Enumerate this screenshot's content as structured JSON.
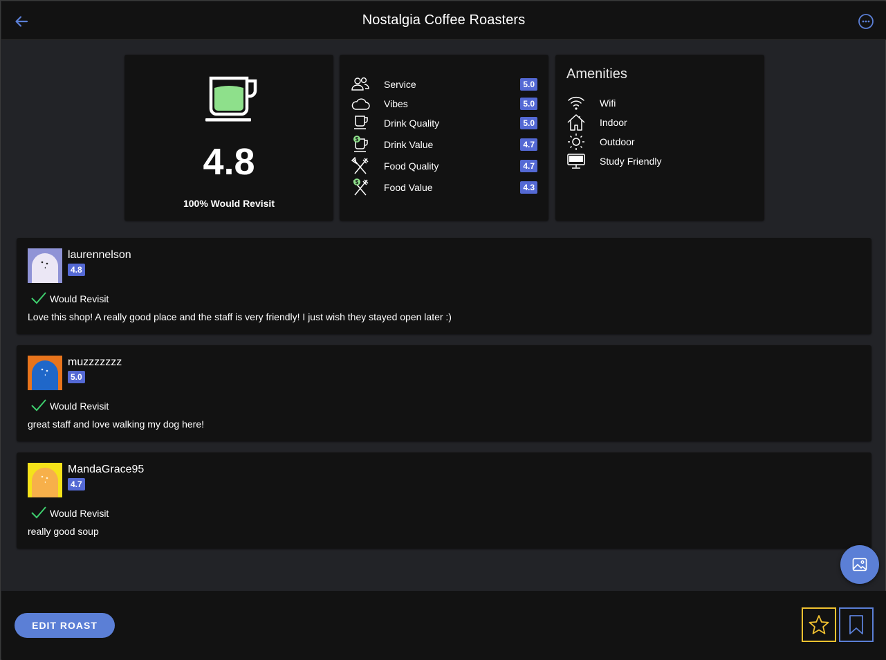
{
  "header": {
    "title": "Nostalgia Coffee Roasters",
    "back_icon": "arrow-left-icon",
    "more_icon": "more-horizontal-circle-icon",
    "accent": "#5b7fd6"
  },
  "summary": {
    "icon": "coffee-cup-icon",
    "cup_fill_color": "#8ee08b",
    "score": "4.8",
    "revisit": "100% Would Revisit"
  },
  "ratings": [
    {
      "label": "Service",
      "value": "5.0",
      "icon": "people-icon"
    },
    {
      "label": "Vibes",
      "value": "5.0",
      "icon": "cloud-icon"
    },
    {
      "label": "Drink Quality",
      "value": "5.0",
      "icon": "cup-icon"
    },
    {
      "label": "Drink Value",
      "value": "4.7",
      "icon": "cup-dollar-icon"
    },
    {
      "label": "Food Quality",
      "value": "4.7",
      "icon": "utensils-icon"
    },
    {
      "label": "Food Value",
      "value": "4.3",
      "icon": "utensils-dollar-icon"
    }
  ],
  "amenities": {
    "title": "Amenities",
    "items": [
      {
        "label": "Wifi",
        "icon": "wifi-icon"
      },
      {
        "label": "Indoor",
        "icon": "house-icon"
      },
      {
        "label": "Outdoor",
        "icon": "sun-icon"
      },
      {
        "label": "Study Friendly",
        "icon": "monitor-icon"
      }
    ]
  },
  "reviews": [
    {
      "user": "laurennelson",
      "rating": "4.8",
      "revisit": "Would Revisit",
      "text": "Love this shop! A really good place and the staff is very friendly! I just wish they stayed open later :)",
      "avatar_bg": "#8f93d6",
      "avatar_ghost": "#ebe7f5"
    },
    {
      "user": "muzzzzzzz",
      "rating": "5.0",
      "revisit": "Would Revisit",
      "text": "great staff and love walking my dog here!",
      "avatar_bg": "#e8741c",
      "avatar_ghost": "#1f67c9"
    },
    {
      "user": "MandaGrace95",
      "rating": "4.7",
      "revisit": "Would Revisit",
      "text": "really good soup",
      "avatar_bg": "#f5e21a",
      "avatar_ghost": "#f7b04a"
    }
  ],
  "fab": {
    "icon": "image-icon"
  },
  "footer": {
    "edit_label": "EDIT ROAST",
    "star_icon": "star-outline-icon",
    "star_color": "#f2c230",
    "bookmark_icon": "bookmark-outline-icon"
  },
  "colors": {
    "badge": "#5469d4",
    "check": "#3ecf6e",
    "card": "#121212",
    "background": "#222327"
  }
}
